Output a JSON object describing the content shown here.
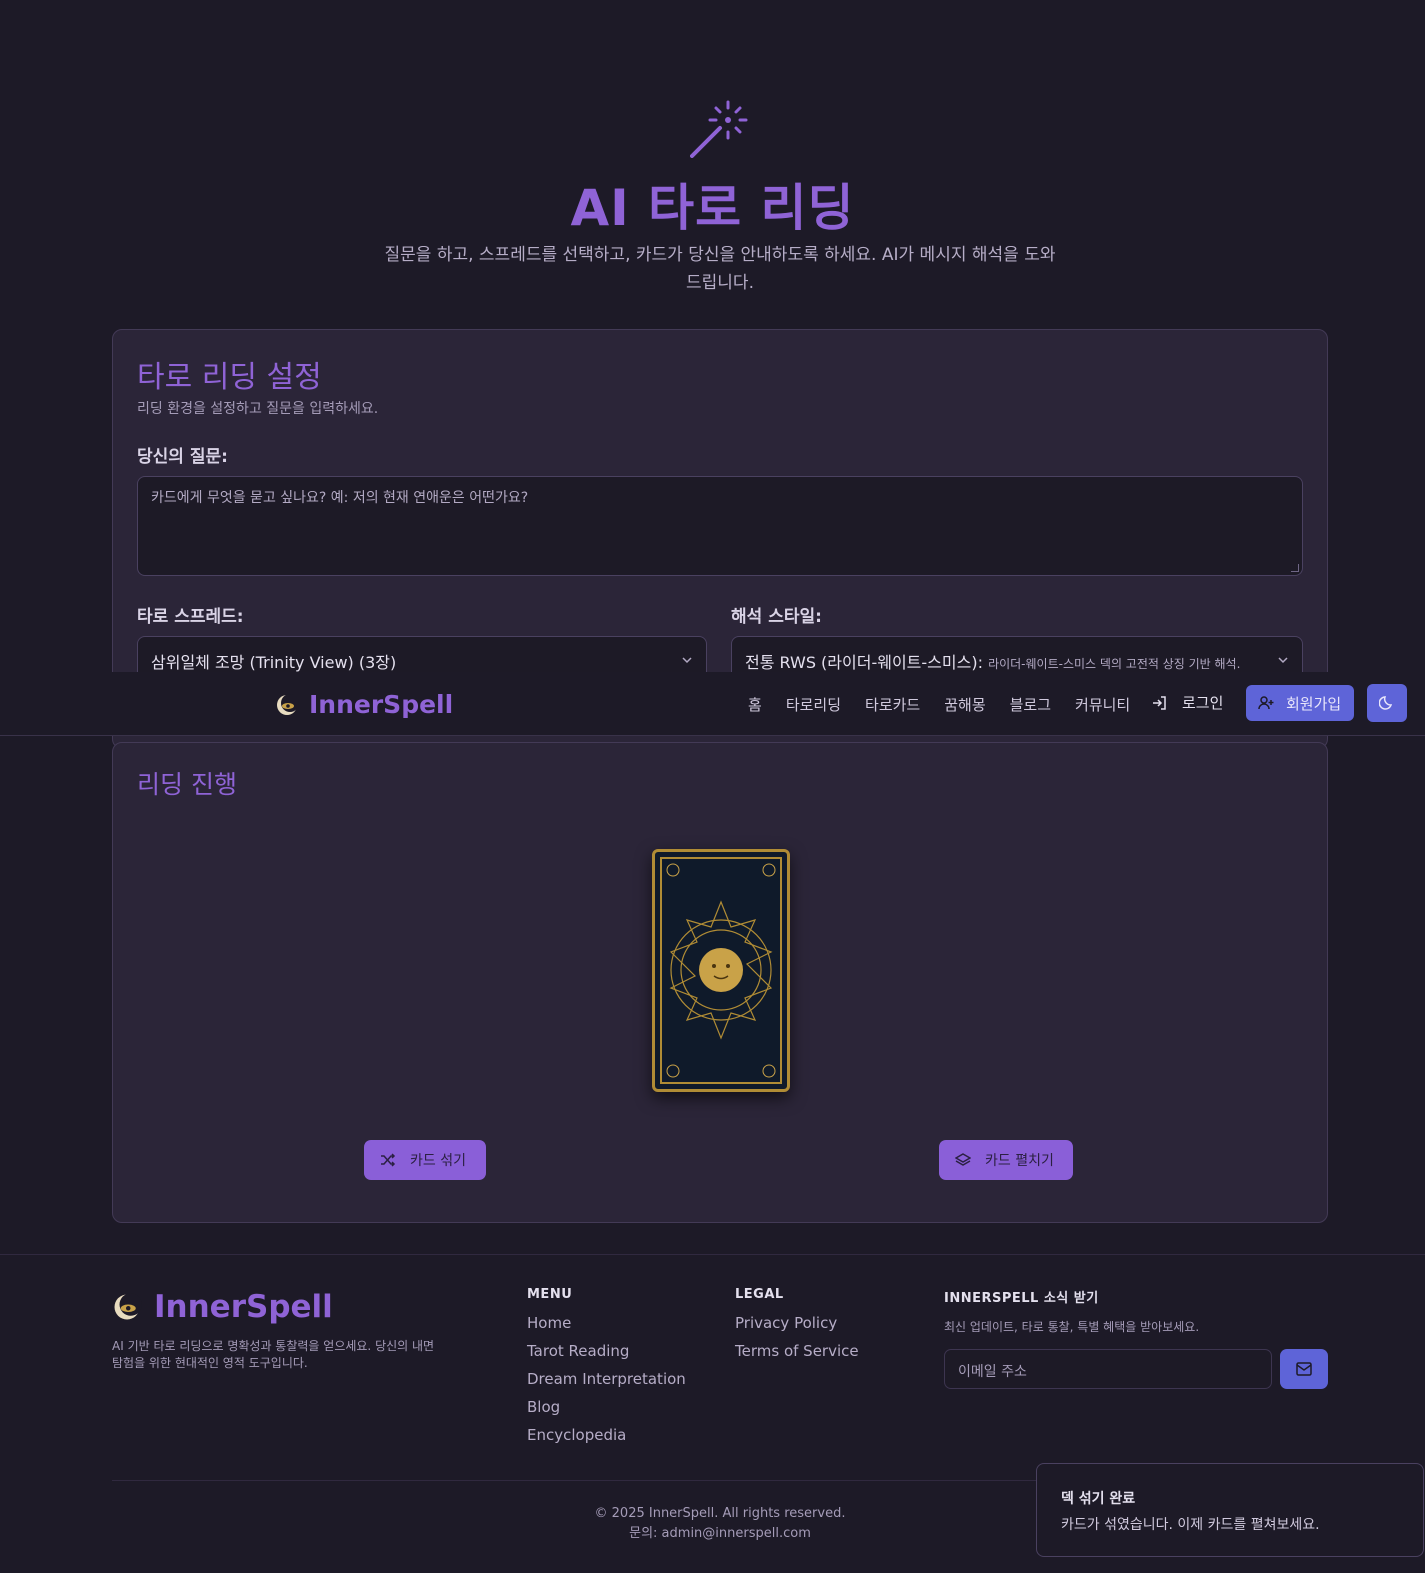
{
  "hero": {
    "title": "AI 타로 리딩",
    "subtitle": "질문을 하고, 스프레드를 선택하고, 카드가 당신을 안내하도록 하세요. AI가 메시지 해석을 도와드립니다.",
    "icon": "magic-wand-icon"
  },
  "settings": {
    "title": "타로 리딩 설정",
    "description": "리딩 환경을 설정하고 질문을 입력하세요.",
    "question_label": "당신의 질문:",
    "question_placeholder": "카드에게 무엇을 묻고 싶나요? 예: 저의 현재 연애운은 어떤가요?",
    "spread_label": "타로 스프레드:",
    "spread_value": "삼위일체 조망 (Trinity View) (3장)",
    "style_label": "해석 스타일:",
    "style_value": "전통 RWS (라이더-웨이트-스미스):",
    "style_detail": "라이더-웨이트-스미스 덱의 고전적 상징 기반 해석."
  },
  "navbar": {
    "brand": "InnerSpell",
    "links": [
      "홈",
      "타로리딩",
      "타로카드",
      "꿈해몽",
      "블로그",
      "커뮤니티"
    ],
    "login": "로그인",
    "signup": "회원가입",
    "accent": "#5e64d8"
  },
  "progress": {
    "title": "리딩 진행",
    "shuffle_button": "카드 섞기",
    "spread_button": "카드 펼치기"
  },
  "footer": {
    "brand": "InnerSpell",
    "description": "AI 기반 타로 리딩으로 명확성과 통찰력을 얻으세요. 당신의 내면 탐험을 위한 현대적인 영적 도구입니다.",
    "menu_heading": "MENU",
    "menu_links": [
      "Home",
      "Tarot Reading",
      "Dream Interpretation",
      "Blog",
      "Encyclopedia"
    ],
    "legal_heading": "LEGAL",
    "legal_links": [
      "Privacy Policy",
      "Terms of Service"
    ],
    "newsletter_heading": "INNERSPELL 소식 받기",
    "newsletter_desc": "최신 업데이트, 타로 통찰, 특별 혜택을 받아보세요.",
    "email_placeholder": "이메일 주소",
    "copyright": "© 2025 InnerSpell. All rights reserved.",
    "contact": "문의: admin@innerspell.com"
  },
  "toast": {
    "title": "덱 섞기 완료",
    "message": "카드가 섞였습니다. 이제 카드를 펼쳐보세요."
  },
  "colors": {
    "background": "#1d1a27",
    "card": "#2b2538",
    "brand_purple": "#8f63d6",
    "button_purple": "#8a5fd8",
    "indigo": "#5e64d8"
  }
}
